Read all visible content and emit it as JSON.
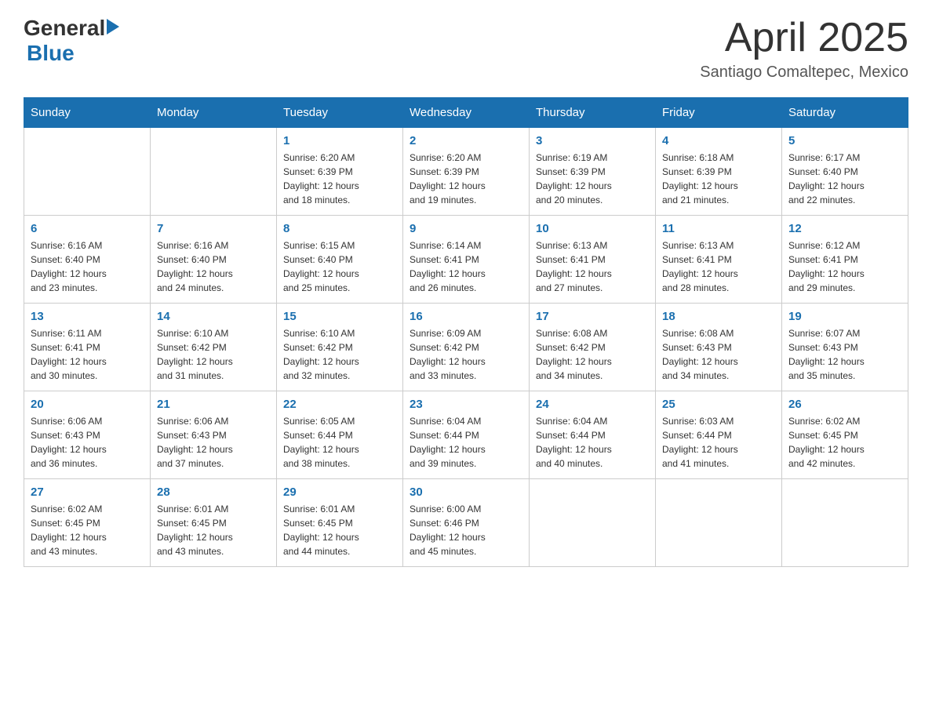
{
  "header": {
    "logo_general": "General",
    "logo_blue": "Blue",
    "title": "April 2025",
    "location": "Santiago Comaltepec, Mexico"
  },
  "days_of_week": [
    "Sunday",
    "Monday",
    "Tuesday",
    "Wednesday",
    "Thursday",
    "Friday",
    "Saturday"
  ],
  "weeks": [
    [
      {
        "day": "",
        "info": ""
      },
      {
        "day": "",
        "info": ""
      },
      {
        "day": "1",
        "info": "Sunrise: 6:20 AM\nSunset: 6:39 PM\nDaylight: 12 hours\nand 18 minutes."
      },
      {
        "day": "2",
        "info": "Sunrise: 6:20 AM\nSunset: 6:39 PM\nDaylight: 12 hours\nand 19 minutes."
      },
      {
        "day": "3",
        "info": "Sunrise: 6:19 AM\nSunset: 6:39 PM\nDaylight: 12 hours\nand 20 minutes."
      },
      {
        "day": "4",
        "info": "Sunrise: 6:18 AM\nSunset: 6:39 PM\nDaylight: 12 hours\nand 21 minutes."
      },
      {
        "day": "5",
        "info": "Sunrise: 6:17 AM\nSunset: 6:40 PM\nDaylight: 12 hours\nand 22 minutes."
      }
    ],
    [
      {
        "day": "6",
        "info": "Sunrise: 6:16 AM\nSunset: 6:40 PM\nDaylight: 12 hours\nand 23 minutes."
      },
      {
        "day": "7",
        "info": "Sunrise: 6:16 AM\nSunset: 6:40 PM\nDaylight: 12 hours\nand 24 minutes."
      },
      {
        "day": "8",
        "info": "Sunrise: 6:15 AM\nSunset: 6:40 PM\nDaylight: 12 hours\nand 25 minutes."
      },
      {
        "day": "9",
        "info": "Sunrise: 6:14 AM\nSunset: 6:41 PM\nDaylight: 12 hours\nand 26 minutes."
      },
      {
        "day": "10",
        "info": "Sunrise: 6:13 AM\nSunset: 6:41 PM\nDaylight: 12 hours\nand 27 minutes."
      },
      {
        "day": "11",
        "info": "Sunrise: 6:13 AM\nSunset: 6:41 PM\nDaylight: 12 hours\nand 28 minutes."
      },
      {
        "day": "12",
        "info": "Sunrise: 6:12 AM\nSunset: 6:41 PM\nDaylight: 12 hours\nand 29 minutes."
      }
    ],
    [
      {
        "day": "13",
        "info": "Sunrise: 6:11 AM\nSunset: 6:41 PM\nDaylight: 12 hours\nand 30 minutes."
      },
      {
        "day": "14",
        "info": "Sunrise: 6:10 AM\nSunset: 6:42 PM\nDaylight: 12 hours\nand 31 minutes."
      },
      {
        "day": "15",
        "info": "Sunrise: 6:10 AM\nSunset: 6:42 PM\nDaylight: 12 hours\nand 32 minutes."
      },
      {
        "day": "16",
        "info": "Sunrise: 6:09 AM\nSunset: 6:42 PM\nDaylight: 12 hours\nand 33 minutes."
      },
      {
        "day": "17",
        "info": "Sunrise: 6:08 AM\nSunset: 6:42 PM\nDaylight: 12 hours\nand 34 minutes."
      },
      {
        "day": "18",
        "info": "Sunrise: 6:08 AM\nSunset: 6:43 PM\nDaylight: 12 hours\nand 34 minutes."
      },
      {
        "day": "19",
        "info": "Sunrise: 6:07 AM\nSunset: 6:43 PM\nDaylight: 12 hours\nand 35 minutes."
      }
    ],
    [
      {
        "day": "20",
        "info": "Sunrise: 6:06 AM\nSunset: 6:43 PM\nDaylight: 12 hours\nand 36 minutes."
      },
      {
        "day": "21",
        "info": "Sunrise: 6:06 AM\nSunset: 6:43 PM\nDaylight: 12 hours\nand 37 minutes."
      },
      {
        "day": "22",
        "info": "Sunrise: 6:05 AM\nSunset: 6:44 PM\nDaylight: 12 hours\nand 38 minutes."
      },
      {
        "day": "23",
        "info": "Sunrise: 6:04 AM\nSunset: 6:44 PM\nDaylight: 12 hours\nand 39 minutes."
      },
      {
        "day": "24",
        "info": "Sunrise: 6:04 AM\nSunset: 6:44 PM\nDaylight: 12 hours\nand 40 minutes."
      },
      {
        "day": "25",
        "info": "Sunrise: 6:03 AM\nSunset: 6:44 PM\nDaylight: 12 hours\nand 41 minutes."
      },
      {
        "day": "26",
        "info": "Sunrise: 6:02 AM\nSunset: 6:45 PM\nDaylight: 12 hours\nand 42 minutes."
      }
    ],
    [
      {
        "day": "27",
        "info": "Sunrise: 6:02 AM\nSunset: 6:45 PM\nDaylight: 12 hours\nand 43 minutes."
      },
      {
        "day": "28",
        "info": "Sunrise: 6:01 AM\nSunset: 6:45 PM\nDaylight: 12 hours\nand 43 minutes."
      },
      {
        "day": "29",
        "info": "Sunrise: 6:01 AM\nSunset: 6:45 PM\nDaylight: 12 hours\nand 44 minutes."
      },
      {
        "day": "30",
        "info": "Sunrise: 6:00 AM\nSunset: 6:46 PM\nDaylight: 12 hours\nand 45 minutes."
      },
      {
        "day": "",
        "info": ""
      },
      {
        "day": "",
        "info": ""
      },
      {
        "day": "",
        "info": ""
      }
    ]
  ]
}
